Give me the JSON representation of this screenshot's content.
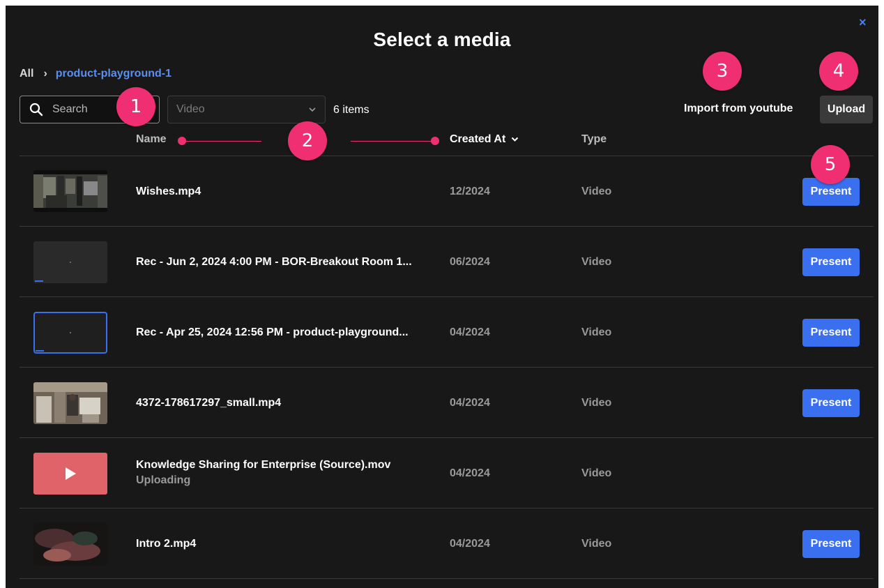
{
  "modal": {
    "title": "Select a media",
    "close_label": "×"
  },
  "breadcrumb": {
    "root": "All",
    "separator": "›",
    "current": "product-playground-1"
  },
  "toolbar": {
    "search_placeholder": "Search",
    "filter_value": "Video",
    "item_count": "6 items",
    "import_label": "Import from youtube",
    "upload_label": "Upload"
  },
  "columns": {
    "name": "Name",
    "created": "Created At",
    "type": "Type"
  },
  "rows": [
    {
      "name": "Wishes.mp4",
      "status": "",
      "date": "12/2024",
      "type": "Video",
      "action": "Present",
      "thumb": "video-frame-office"
    },
    {
      "name": "Rec - Jun 2, 2024 4:00 PM - BOR-Breakout Room 1...",
      "status": "",
      "date": "06/2024",
      "type": "Video",
      "action": "Present",
      "thumb": "recording-dark"
    },
    {
      "name": "Rec - Apr 25, 2024 12:56 PM - product-playground...",
      "status": "",
      "date": "04/2024",
      "type": "Video",
      "action": "Present",
      "thumb": "recording-dark-selected"
    },
    {
      "name": "4372-178617297_small.mp4",
      "status": "",
      "date": "04/2024",
      "type": "Video",
      "action": "Present",
      "thumb": "video-frame-lab"
    },
    {
      "name": "Knowledge Sharing for Enterprise (Source).mov",
      "status": "Uploading",
      "date": "04/2024",
      "type": "Video",
      "action": "",
      "thumb": "play-placeholder"
    },
    {
      "name": "Intro 2.mp4",
      "status": "",
      "date": "04/2024",
      "type": "Video",
      "action": "Present",
      "thumb": "video-frame-smoke"
    }
  ],
  "annotations": [
    "1",
    "2",
    "3",
    "4",
    "5"
  ],
  "colors": {
    "background": "#181818",
    "accent": "#3a6ff0",
    "link": "#5b8fef",
    "annotation": "#ef2f72",
    "upload_placeholder": "#e0636a"
  }
}
